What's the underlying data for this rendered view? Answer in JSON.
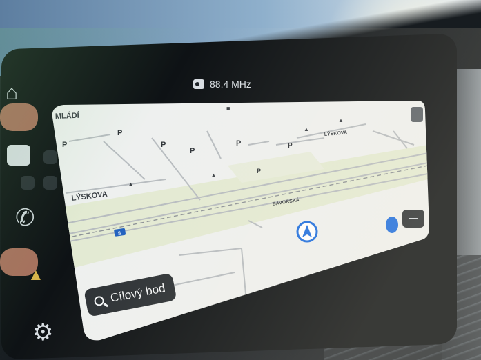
{
  "status_bar": {
    "radio_icon": "radio-icon",
    "frequency": "88.4 MHz"
  },
  "map": {
    "street_labels": [
      "MLÁDÍ",
      "LÝSKOVA",
      "LÝSKOVA",
      "BAVORSKÁ"
    ],
    "parking_label": "P",
    "road_shield": "8"
  },
  "search": {
    "icon": "search-icon",
    "label": "Cílový bod"
  },
  "left_controls": [
    "home-icon",
    "media-icon",
    "phone-icon",
    "navigation-icon",
    "settings-icon"
  ],
  "colors": {
    "map_background": "#eef0ef",
    "park_green": "#e3ead3",
    "nav_arrow": "#1f6fe0",
    "search_bg": "#2b3034"
  }
}
